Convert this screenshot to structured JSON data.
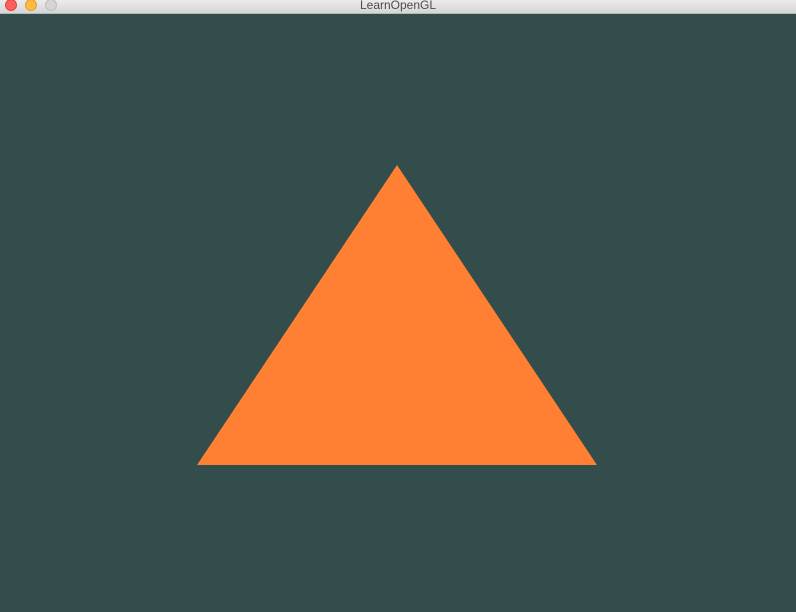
{
  "window": {
    "title": "LearnOpenGL"
  },
  "scene": {
    "clear_color": "#334D4D",
    "shape": "triangle",
    "fill_color": "#FF7F33"
  },
  "icons": {
    "close": "close-icon",
    "minimize": "minimize-icon",
    "zoom": "zoom-icon"
  }
}
